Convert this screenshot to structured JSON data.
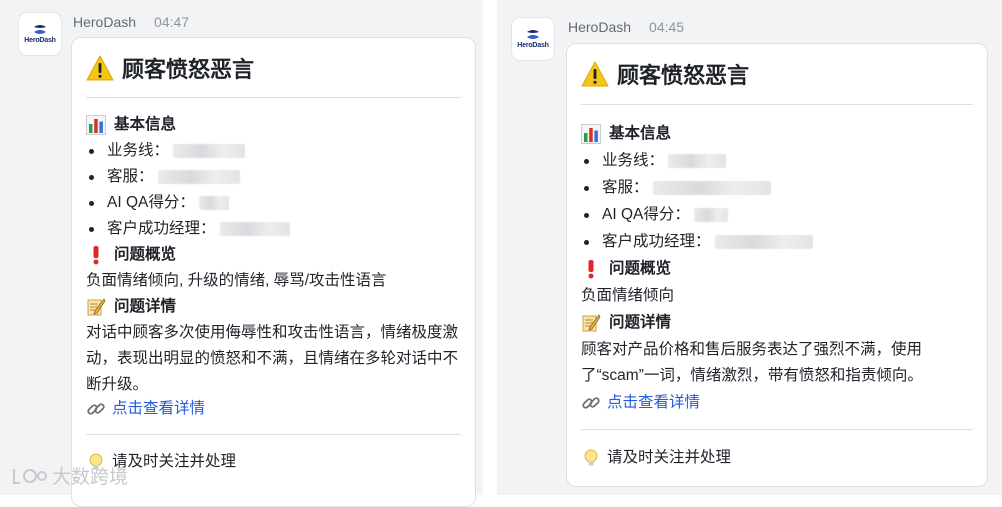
{
  "cards": [
    {
      "app_name": "HeroDash",
      "time": "04:47",
      "avatar_brand": "HeroDash",
      "title": "顾客愤怒恶言",
      "basic_info_heading": "基本信息",
      "fields": [
        {
          "label": "业务线："
        },
        {
          "label": "客服："
        },
        {
          "label": "AI QA得分："
        },
        {
          "label": "客户成功经理："
        }
      ],
      "overview_heading": "问题概览",
      "overview_text": "负面情绪倾向, 升级的情绪, 辱骂/攻击性语言",
      "details_heading": "问题详情",
      "details_lines": [
        "对话中顾客多次使用侮辱性和攻击性语言，情绪极度激",
        "动，表现出明显的愤怒和不满，且情绪在多轮对话中不",
        "断升级。"
      ],
      "link_text": "点击查看详情",
      "footer_text": "请及时关注并处理"
    },
    {
      "app_name": "HeroDash",
      "time": "04:45",
      "avatar_brand": "HeroDash",
      "title": "顾客愤怒恶言",
      "basic_info_heading": "基本信息",
      "fields": [
        {
          "label": "业务线："
        },
        {
          "label": "客服："
        },
        {
          "label": "AI QA得分："
        },
        {
          "label": "客户成功经理："
        }
      ],
      "overview_heading": "问题概览",
      "overview_text": "负面情绪倾向",
      "details_heading": "问题详情",
      "details_lines": [
        "顾客对产品价格和售后服务表达了强烈不满，使用",
        "了“scam”一词，情绪激烈，带有愤怒和指责倾向。"
      ],
      "link_text": "点击查看详情",
      "footer_text": "请及时关注并处理"
    }
  ],
  "watermark": "大数跨境",
  "colors": {
    "link": "#245bdb",
    "brand": "#1a2a6c",
    "warning": "#f5c518"
  }
}
